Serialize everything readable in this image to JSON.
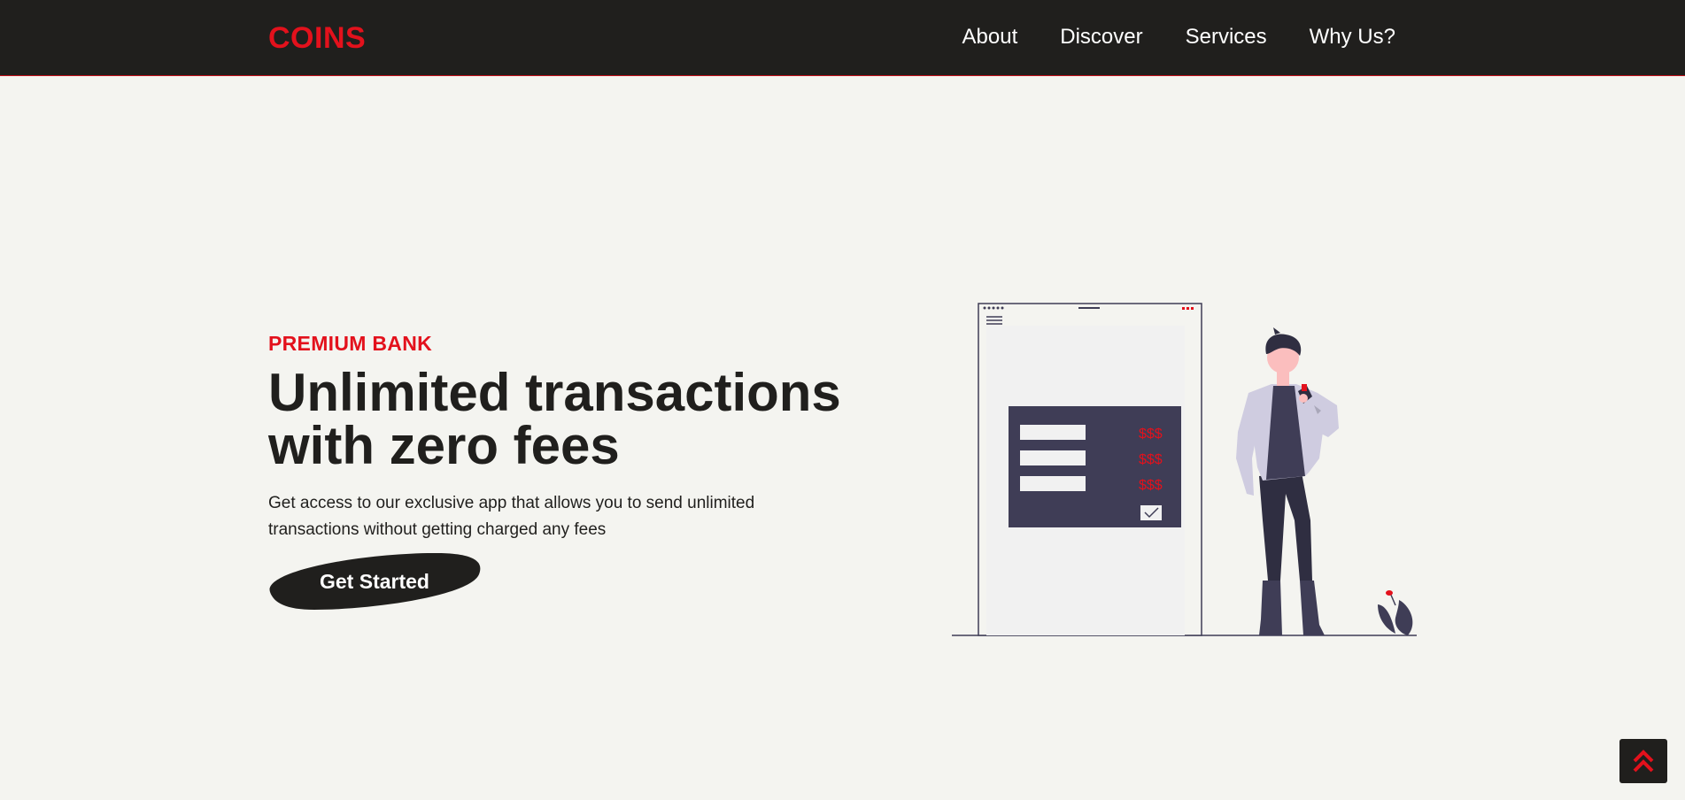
{
  "brand": {
    "logo": "COINS",
    "accent_color": "#e3111c",
    "dark_color": "#201f1d",
    "background_color": "#f4f4f0"
  },
  "nav": {
    "items": [
      {
        "label": "About"
      },
      {
        "label": "Discover"
      },
      {
        "label": "Services"
      },
      {
        "label": "Why Us?"
      }
    ]
  },
  "hero": {
    "eyebrow": "PREMIUM BANK",
    "headline": "Unlimited transactions with zero fees",
    "description": "Get access to our exclusive app that allows you to send unlimited transactions without getting charged any fees",
    "cta_label": "Get Started"
  },
  "illustration": {
    "amounts": [
      "$$$",
      "$$$",
      "$$$"
    ],
    "icon": "mobile-payment-illustration"
  },
  "scroll_top": {
    "icon": "double-chevron-up-icon"
  }
}
